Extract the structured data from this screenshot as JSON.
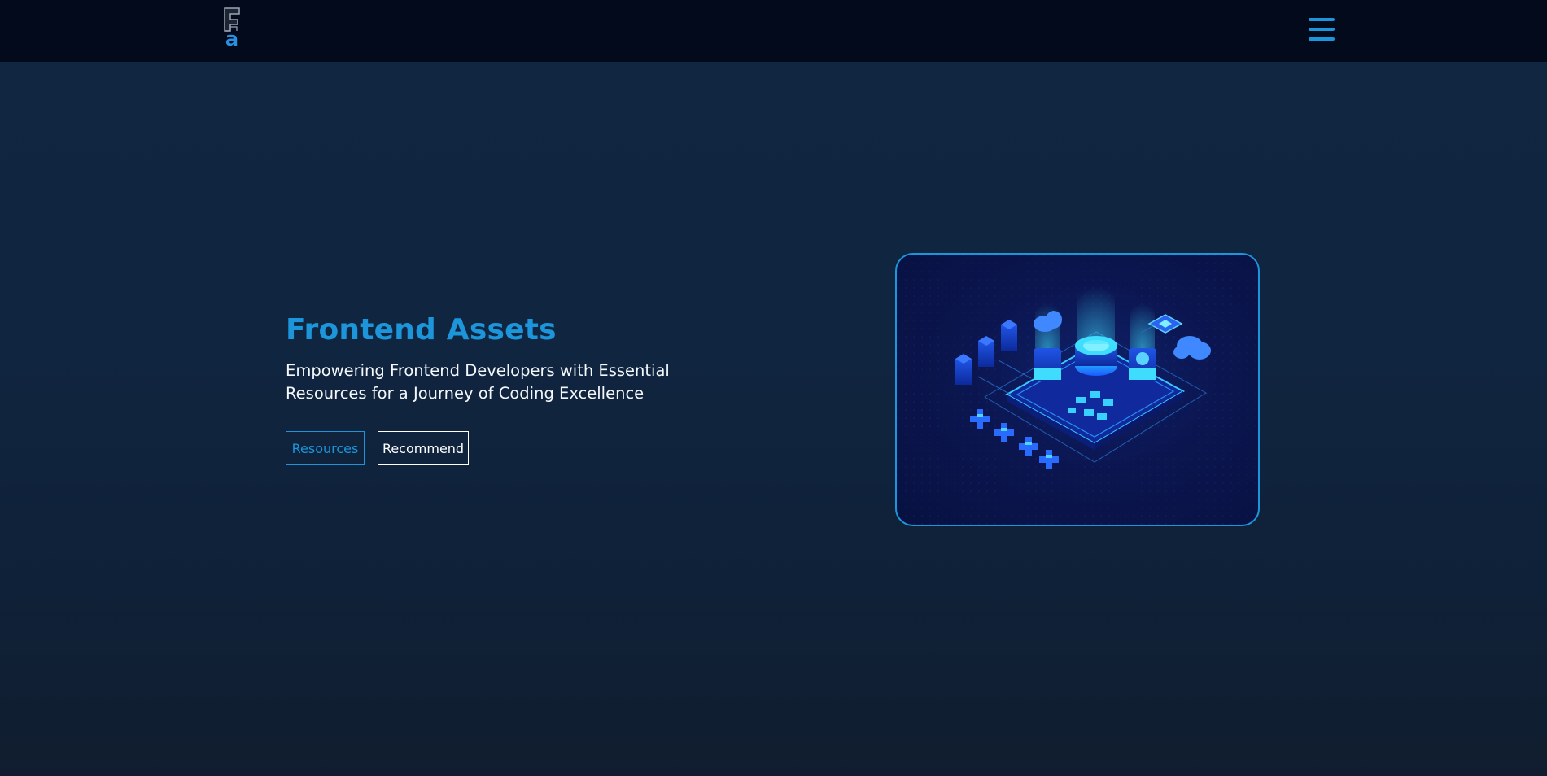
{
  "header": {
    "logo_letters": "Fa",
    "menu_icon": "hamburger-menu-icon"
  },
  "hero": {
    "title": "Frontend Assets",
    "subtitle": "Empowering Frontend Developers with Essential Resources for a Journey of Coding Excellence",
    "buttons": {
      "resources_label": "Resources",
      "recommend_label": "Recommend"
    },
    "illustration": "isometric-tech-platform-illustration"
  },
  "colors": {
    "accent": "#1c95db",
    "header_bg": "#020a1c",
    "page_bg": "#112741",
    "card_bg": "#0b1650"
  }
}
